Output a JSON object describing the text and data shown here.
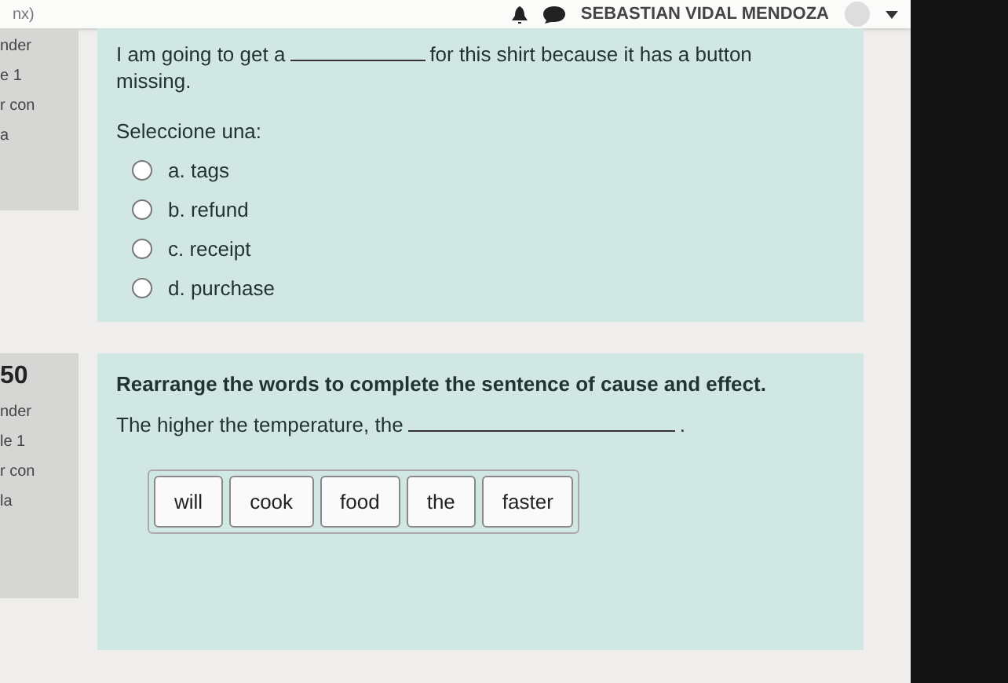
{
  "topbar": {
    "left_text": "nx)",
    "user_name": "SEBASTIAN VIDAL MENDOZA"
  },
  "questions": [
    {
      "kind": "choice",
      "info": [
        "nder",
        "e 1",
        "r con",
        "a"
      ],
      "text_before": "I am going to get a",
      "text_after": "for this shirt because it has a button missing.",
      "prompt": "Seleccione una:",
      "options": [
        {
          "label": "a. tags",
          "selected": false
        },
        {
          "label": "b. refund",
          "selected": false
        },
        {
          "label": "c. receipt",
          "selected": false
        },
        {
          "label": "d. purchase",
          "selected": false
        }
      ]
    },
    {
      "kind": "order",
      "number": "50",
      "info": [
        "nder",
        "le 1",
        "r con",
        "la"
      ],
      "instruction": "Rearrange the words to complete the sentence of cause and effect.",
      "text_before": "The higher the temperature, the",
      "text_after": ".",
      "words": [
        "will",
        "cook",
        "food",
        "the",
        "faster"
      ]
    }
  ]
}
